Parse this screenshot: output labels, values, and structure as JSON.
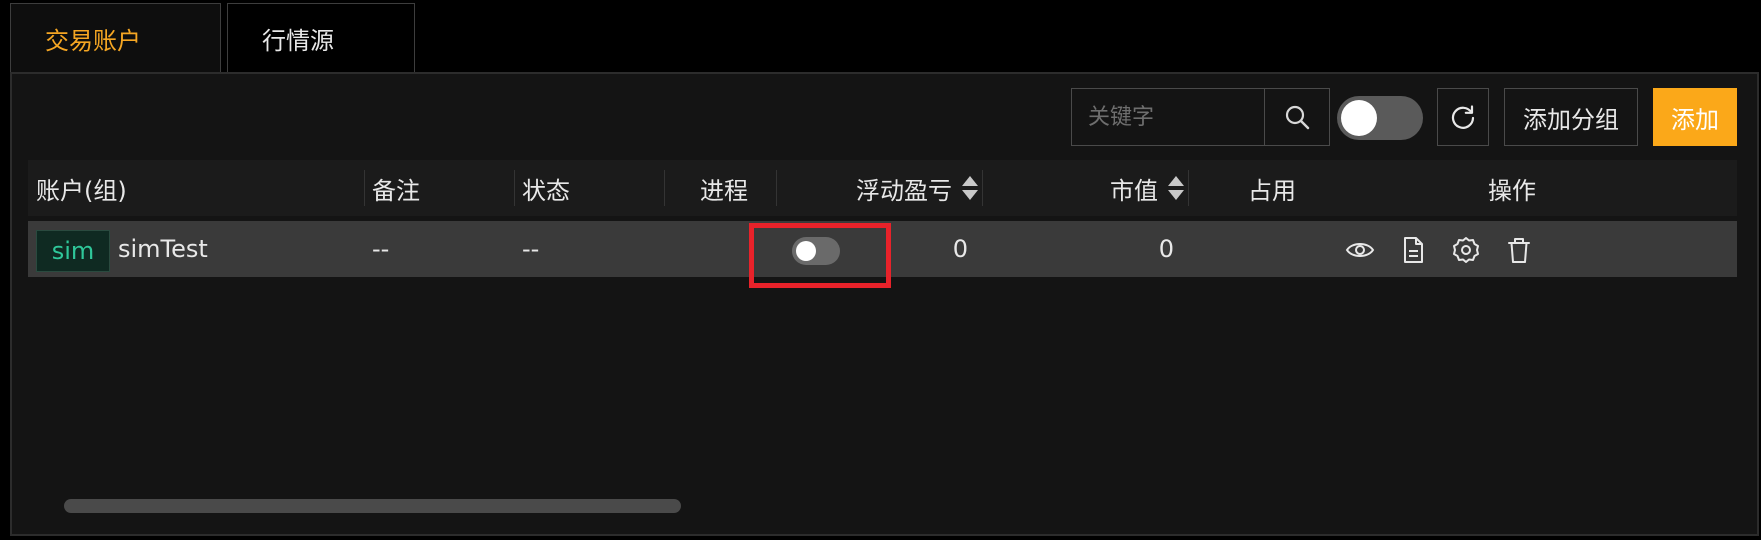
{
  "tabs": [
    {
      "label": "交易账户",
      "active": true
    },
    {
      "label": "行情源",
      "active": false
    }
  ],
  "toolbar": {
    "search_placeholder": "关键字",
    "search_value": "",
    "switch_on": false,
    "add_group_label": "添加分组",
    "add_label": "添加"
  },
  "table": {
    "columns": [
      {
        "label": "账户(组)"
      },
      {
        "label": "备注"
      },
      {
        "label": "状态"
      },
      {
        "label": "进程"
      },
      {
        "label": "浮动盈亏",
        "sortable": true
      },
      {
        "label": "市值",
        "sortable": true
      },
      {
        "label": "占用"
      },
      {
        "label": "操作"
      }
    ],
    "rows": [
      {
        "badge": "sim",
        "account": "simTest",
        "remark": "--",
        "status": "--",
        "process_on": false,
        "floating_pnl": "0",
        "market_value": "0"
      }
    ]
  },
  "icons": {
    "search": "search-icon",
    "refresh": "refresh-icon",
    "view": "eye-icon",
    "log": "document-icon",
    "settings": "gear-icon",
    "delete": "trash-icon"
  },
  "colors": {
    "accent": "#f5a623",
    "add_button": "#fba819",
    "badge_text": "#2fc79a",
    "highlight": "#e8222a"
  }
}
